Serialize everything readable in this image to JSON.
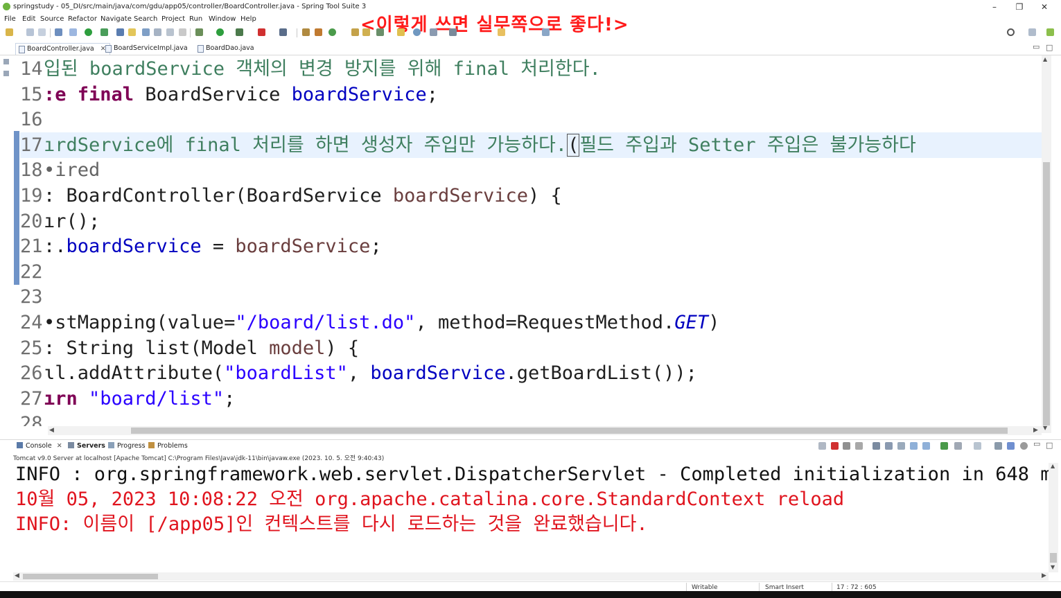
{
  "window": {
    "title": "springstudy - 05_DI/src/main/java/com/gdu/app05/controller/BoardController.java - Spring Tool Suite 3",
    "minimize": "–",
    "restore": "❐",
    "close": "✕"
  },
  "overlay_caption": "<이렇게 쓰면 실무쪽으로 좋다!>",
  "menu": [
    "File",
    "Edit",
    "Source",
    "Refactor",
    "Navigate",
    "Search",
    "Project",
    "Run",
    "Window",
    "Help"
  ],
  "editor_tabs": [
    {
      "label": "BoardController.java",
      "active": true,
      "close": "✕"
    },
    {
      "label": "BoardServiceImpl.java",
      "active": false
    },
    {
      "label": "BoardDao.java",
      "active": false
    }
  ],
  "editor_lines": [
    {
      "num": "14",
      "tokens": [
        {
          "t": "입된 boardService 객체의 변경 방지를 위해 final 처리한다.",
          "c": "comment"
        }
      ]
    },
    {
      "num": "15",
      "tokens": [
        {
          "t": ":e ",
          "c": "keyword"
        },
        {
          "t": "final",
          "c": "keyword"
        },
        {
          "t": " BoardService ",
          "c": "plain"
        },
        {
          "t": "boardService",
          "c": "field"
        },
        {
          "t": ";",
          "c": "plain"
        }
      ]
    },
    {
      "num": "16",
      "tokens": []
    },
    {
      "num": "17",
      "current": true,
      "tokens": [
        {
          "t": "ırdService에 final 처리를 하면 생성자 주입만 가능하다.",
          "c": "comment"
        },
        {
          "t": "(",
          "c": "caret"
        },
        {
          "t": "필드 주입과 Setter 주입은 불가능하다",
          "c": "comment"
        }
      ]
    },
    {
      "num": "18",
      "tokens": [
        {
          "t": "•ired",
          "c": "annot"
        }
      ]
    },
    {
      "num": "19",
      "tokens": [
        {
          "t": ": BoardController(BoardService ",
          "c": "plain"
        },
        {
          "t": "boardService",
          "c": "param"
        },
        {
          "t": ") {",
          "c": "plain"
        }
      ]
    },
    {
      "num": "20",
      "tokens": [
        {
          "t": "ır();",
          "c": "plain"
        }
      ]
    },
    {
      "num": "21",
      "tokens": [
        {
          "t": ":.",
          "c": "plain"
        },
        {
          "t": "boardService",
          "c": "field"
        },
        {
          "t": " = ",
          "c": "plain"
        },
        {
          "t": "boardService",
          "c": "param"
        },
        {
          "t": ";",
          "c": "plain"
        }
      ]
    },
    {
      "num": "22",
      "tokens": []
    },
    {
      "num": "23",
      "tokens": []
    },
    {
      "num": "24",
      "tokens": [
        {
          "t": "•stMapping(value=",
          "c": "plain"
        },
        {
          "t": "\"/board/list.do\"",
          "c": "string"
        },
        {
          "t": ", method=RequestMethod.",
          "c": "plain"
        },
        {
          "t": "GET",
          "c": "static"
        },
        {
          "t": ")",
          "c": "plain"
        }
      ]
    },
    {
      "num": "25",
      "tokens": [
        {
          "t": ": String list(Model ",
          "c": "plain"
        },
        {
          "t": "model",
          "c": "param"
        },
        {
          "t": ") {",
          "c": "plain"
        }
      ]
    },
    {
      "num": "26",
      "tokens": [
        {
          "t": "ɩl.addAttribute(",
          "c": "plain"
        },
        {
          "t": "\"boardList\"",
          "c": "string"
        },
        {
          "t": ", ",
          "c": "plain"
        },
        {
          "t": "boardService",
          "c": "field"
        },
        {
          "t": ".getBoardList());",
          "c": "plain"
        }
      ]
    },
    {
      "num": "27",
      "tokens": [
        {
          "t": "ırn ",
          "c": "keyword"
        },
        {
          "t": "\"board/list\"",
          "c": "string"
        },
        {
          "t": ";",
          "c": "plain"
        }
      ]
    },
    {
      "num": "28",
      "tokens": []
    }
  ],
  "console_tabs": [
    {
      "label": "Console",
      "active": false,
      "close": "✕"
    },
    {
      "label": "Servers",
      "active": true
    },
    {
      "label": "Progress",
      "active": false
    },
    {
      "label": "Problems",
      "active": false
    }
  ],
  "console": {
    "process_label": "Tomcat v9.0 Server at localhost [Apache Tomcat] C:\\Program Files\\Java\\jdk-11\\bin\\javaw.exe  (2023. 10. 5. 오전 9:40:43)",
    "lines": [
      {
        "text": "INFO : org.springframework.web.servlet.DispatcherServlet - Completed initialization in 648 ms",
        "style": "info"
      },
      {
        "text": "10월 05, 2023 10:08:22 오전 org.apache.catalina.core.StandardContext reload",
        "style": "err"
      },
      {
        "text": "INFO: 이름이 [/app05]인 컨텍스트를 다시 로드하는 것을 완료했습니다.",
        "style": "err"
      }
    ]
  },
  "status": {
    "mode": "Writable",
    "insert": "Smart Insert",
    "position": "17 : 72 : 605"
  },
  "colors": {
    "comment": "#3f7f5f",
    "keyword": "#7f0055",
    "field": "#0000c0",
    "string": "#2a00ff",
    "console_error": "#e0141e",
    "overlay": "#ff1a1a"
  }
}
